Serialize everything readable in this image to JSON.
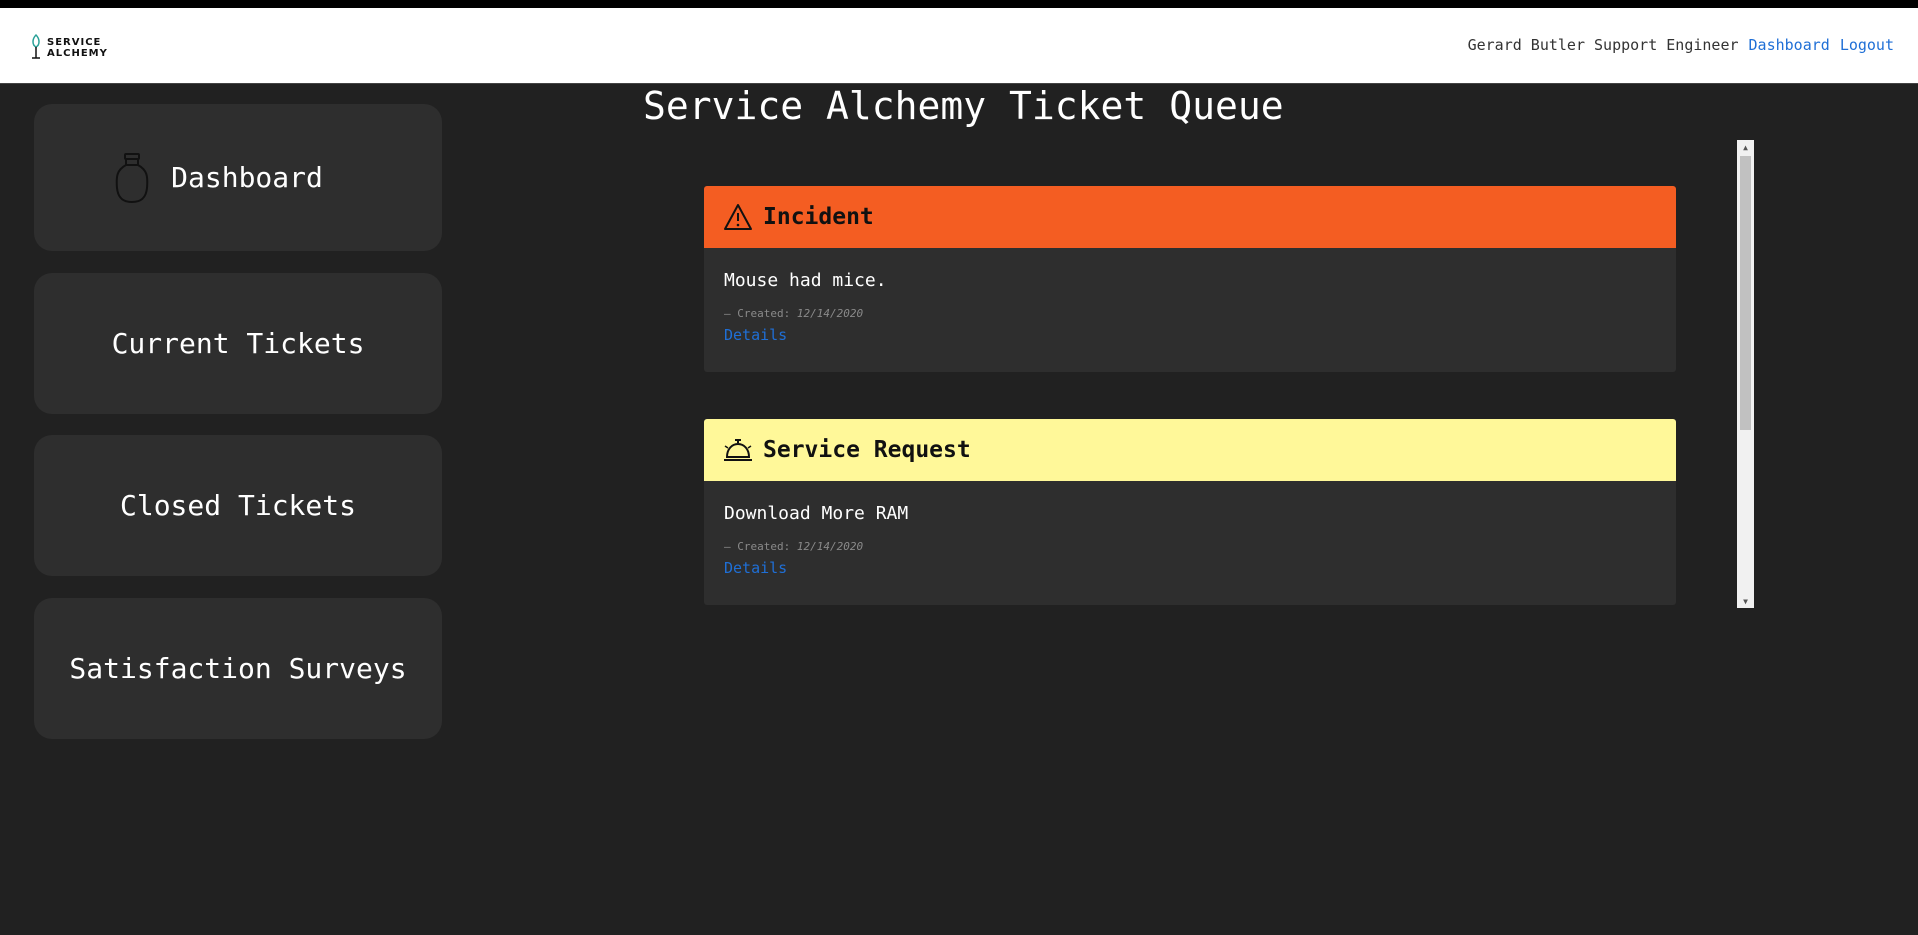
{
  "brand": {
    "line1": "SERVICE",
    "line2": "ALCHEMY"
  },
  "nav": {
    "user": "Gerard Butler Support Engineer",
    "dashboard_link": "Dashboard",
    "logout_link": "Logout"
  },
  "sidebar": {
    "items": [
      {
        "label": "Dashboard",
        "icon": "jar-icon"
      },
      {
        "label": "Current Tickets"
      },
      {
        "label": "Closed Tickets"
      },
      {
        "label": "Satisfaction Surveys"
      }
    ]
  },
  "page": {
    "title": "Service Alchemy Ticket Queue"
  },
  "tickets": [
    {
      "type": "Incident",
      "icon": "warning-icon",
      "color": "#f45d22",
      "description": "Mouse had mice.",
      "created_prefix": "— Created:",
      "created_date": "12/14/2020",
      "details": "Details"
    },
    {
      "type": "Service Request",
      "icon": "service-bell-icon",
      "color": "#fff899",
      "description": "Download More RAM",
      "created_prefix": "— Created:",
      "created_date": "12/14/2020",
      "details": "Details"
    }
  ]
}
